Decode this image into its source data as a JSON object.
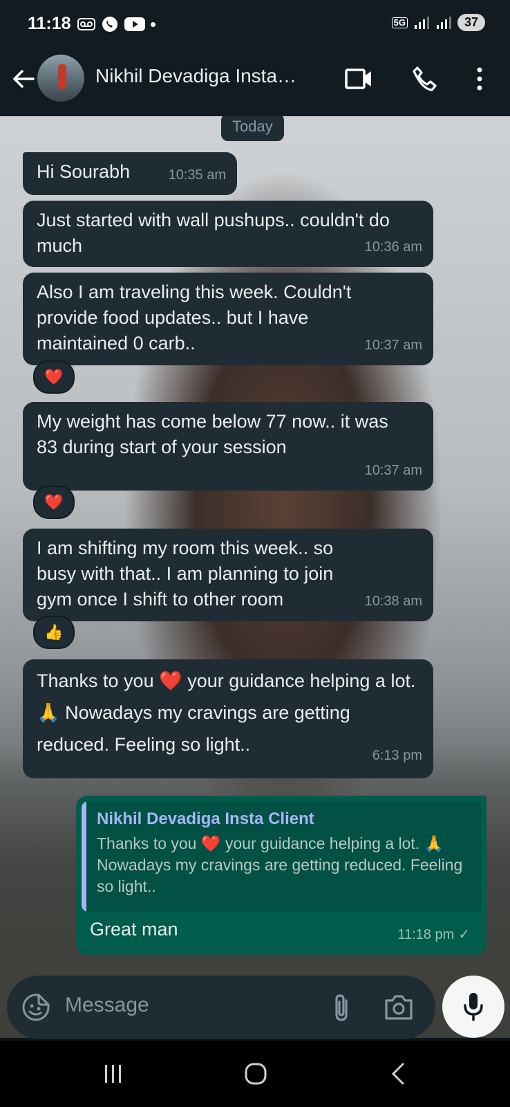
{
  "status_bar": {
    "time": "11:18",
    "network": "5G",
    "battery": "37"
  },
  "header": {
    "contact_name": "Nikhil Devadiga Insta…",
    "icons": [
      "back-arrow-icon",
      "video-call-icon",
      "phone-call-icon",
      "more-options-icon"
    ]
  },
  "chat": {
    "date_label": "Today",
    "messages": [
      {
        "text": "Hi Sourabh",
        "time": "10:35 am"
      },
      {
        "text": "Just started with wall pushups.. couldn't do much",
        "time": "10:36 am"
      },
      {
        "text": "Also I am traveling this week. Couldn't provide food updates.. but I have maintained 0 carb..",
        "time": "10:37 am",
        "reaction": "❤️"
      },
      {
        "text": "My weight has come below 77 now.. it was 83 during start of your session",
        "time": "10:37 am",
        "reaction": "❤️"
      },
      {
        "text": "I am shifting my room this week.. so busy with that.. I am planning to join gym once I shift to other room",
        "time": "10:38 am",
        "reaction": "👍"
      },
      {
        "text_a": "Thanks to you ",
        "emoji_a": "❤️",
        "text_b": " your guidance helping a lot. ",
        "emoji_b": "🙏",
        "text_c": " Nowadays my cravings are getting reduced. Feeling so light..",
        "time": "6:13 pm"
      }
    ],
    "outgoing": {
      "quote_name": "Nikhil Devadiga Insta Client",
      "quote_text_a": "Thanks to you ",
      "quote_emoji_a": "❤️",
      "quote_text_b": " your guidance helping a lot. ",
      "quote_emoji_b": "🙏",
      "quote_text_c": " Nowadays my cravings are getting reduced. Feeling so light..",
      "text": "Great man",
      "time": "11:18 pm",
      "status_tick": "✓"
    }
  },
  "input": {
    "placeholder": "Message"
  },
  "colors": {
    "header_bg": "#111b21",
    "incoming_bubble": "#202c33",
    "outgoing_bubble": "#005c4b",
    "quote_accent": "#a5b6f5",
    "timestamp": "#8696a0"
  }
}
